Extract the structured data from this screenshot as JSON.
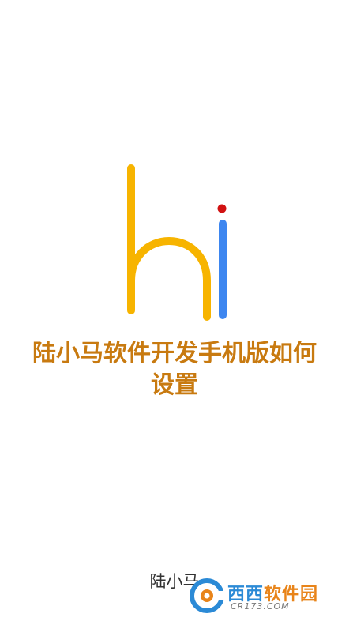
{
  "splash": {
    "logo_text": "hi",
    "title_line1": "陆小马软件开发手机版如何",
    "title_line2": "设置",
    "author": "陆小马"
  },
  "watermark": {
    "brand_left": "西西",
    "brand_right": "软件园",
    "url": "CR173.COM"
  },
  "colors": {
    "logo_h": "#f7b400",
    "logo_i": "#3d86f0",
    "logo_dot": "#d11212",
    "title": "#c87a10",
    "author": "#333333",
    "background": "#ffffff"
  }
}
